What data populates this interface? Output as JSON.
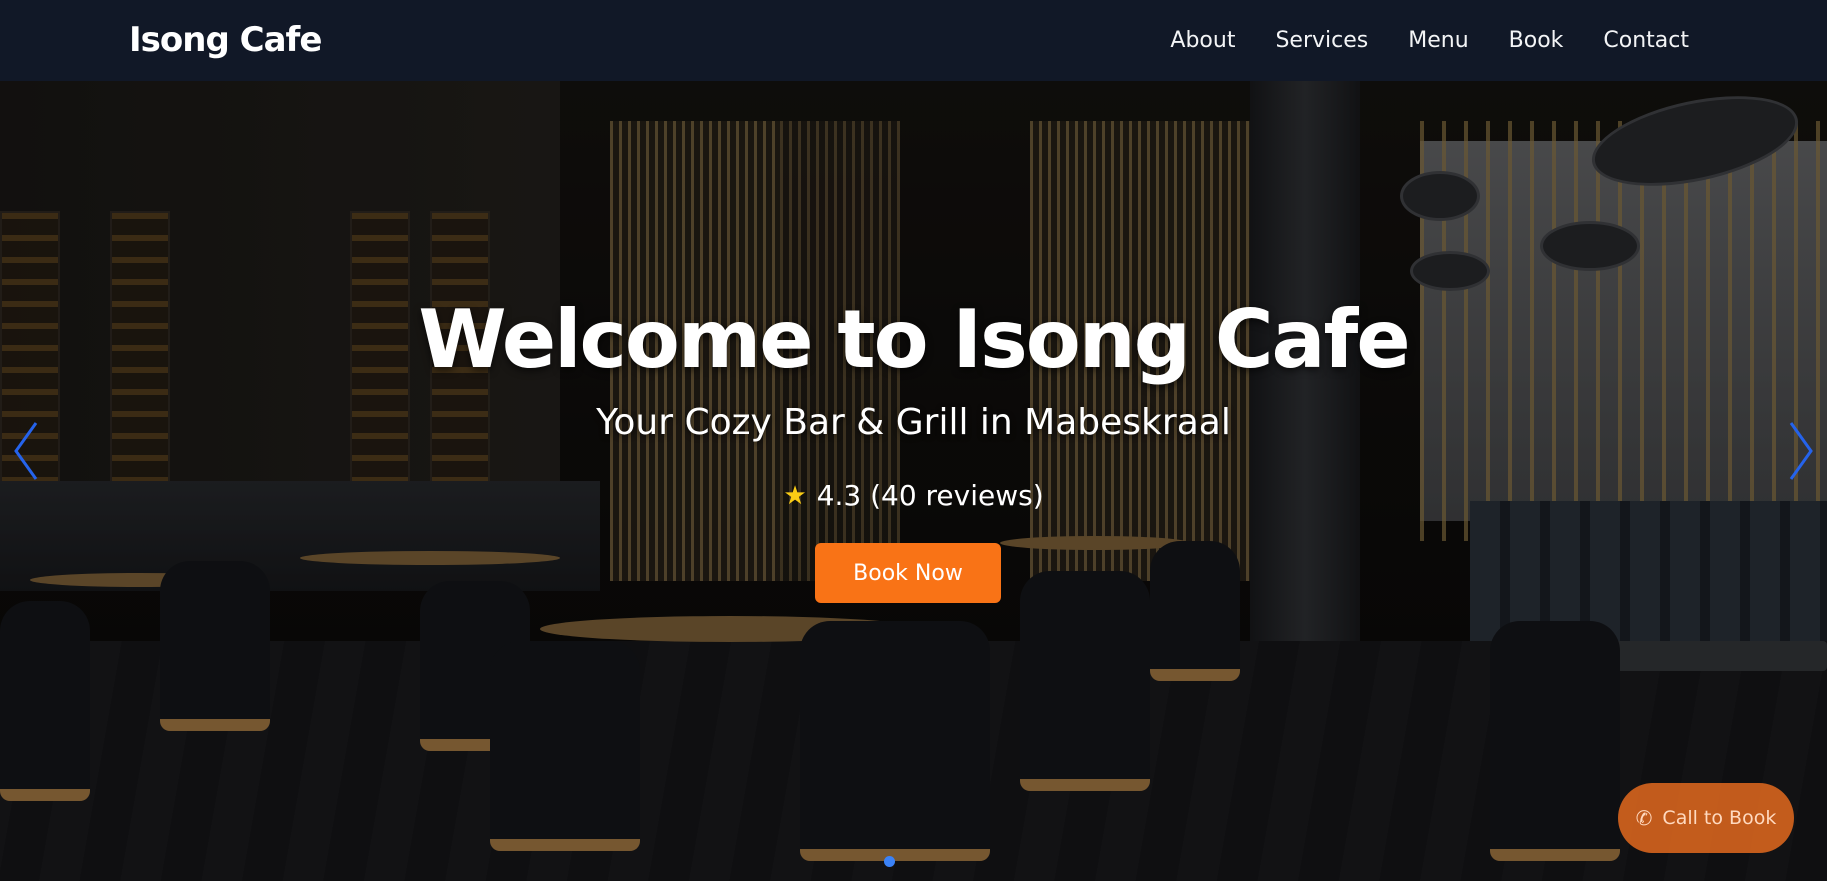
{
  "header": {
    "brand": "Isong Cafe",
    "nav": [
      "About",
      "Services",
      "Menu",
      "Book",
      "Contact"
    ]
  },
  "hero": {
    "title": "Welcome to Isong Cafe",
    "subtitle": "Your Cozy Bar & Grill in Mabeskraal",
    "rating_icon": "star-icon",
    "rating_text": "4.3 (40 reviews)",
    "cta_label": "Book Now",
    "carousel": {
      "prev_icon": "chevron-left-icon",
      "next_icon": "chevron-right-icon",
      "active_slide": 1
    }
  },
  "floating": {
    "call_icon": "phone-icon",
    "call_label": "Call to Book"
  },
  "colors": {
    "nav_bg": "#111827",
    "accent": "#f97316",
    "carousel_arrow": "#2563eb",
    "star": "#facc15"
  }
}
